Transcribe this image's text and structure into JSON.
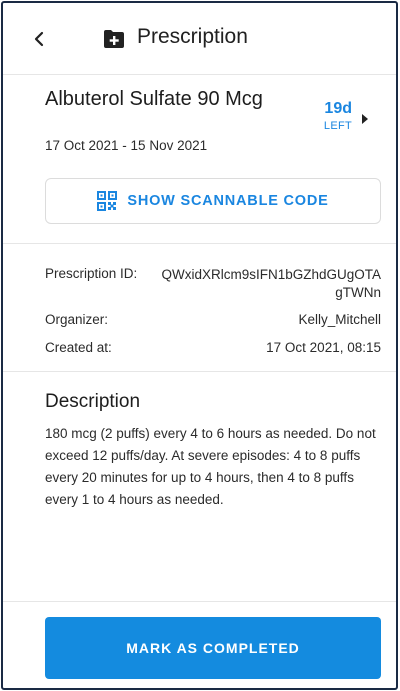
{
  "header": {
    "title": "Prescription"
  },
  "medication": {
    "name": "Albuterol Sulfate 90 Mcg",
    "date_range": "17 Oct 2021 - 15 Nov 2021",
    "days_left_value": "19d",
    "days_left_label": "LEFT"
  },
  "scan_button": {
    "label": "SHOW SCANNABLE CODE"
  },
  "details": {
    "prescription_id_label": "Prescription ID:",
    "prescription_id_value": "QWxidXRlcm9sIFN1bGZhdGUgOTAgTWNn",
    "organizer_label": "Organizer:",
    "organizer_value": "Kelly_Mitchell",
    "created_label": "Created at:",
    "created_value": "17 Oct 2021, 08:15"
  },
  "description": {
    "title": "Description",
    "text": "180 mcg (2 puffs) every 4 to 6 hours as needed. Do not exceed 12 puffs/day. At severe episodes: 4 to 8 puffs every 20 minutes for up to 4 hours, then 4 to 8 puffs every 1 to 4 hours as needed."
  },
  "actions": {
    "complete_label": "MARK AS COMPLETED"
  },
  "colors": {
    "accent": "#1a86e0",
    "button": "#148bdf",
    "border": "#1a2a44"
  },
  "icons": {
    "back": "chevron-left-icon",
    "title": "medical-folder-icon",
    "days": "chevron-right-icon",
    "scan": "qr-code-icon"
  }
}
